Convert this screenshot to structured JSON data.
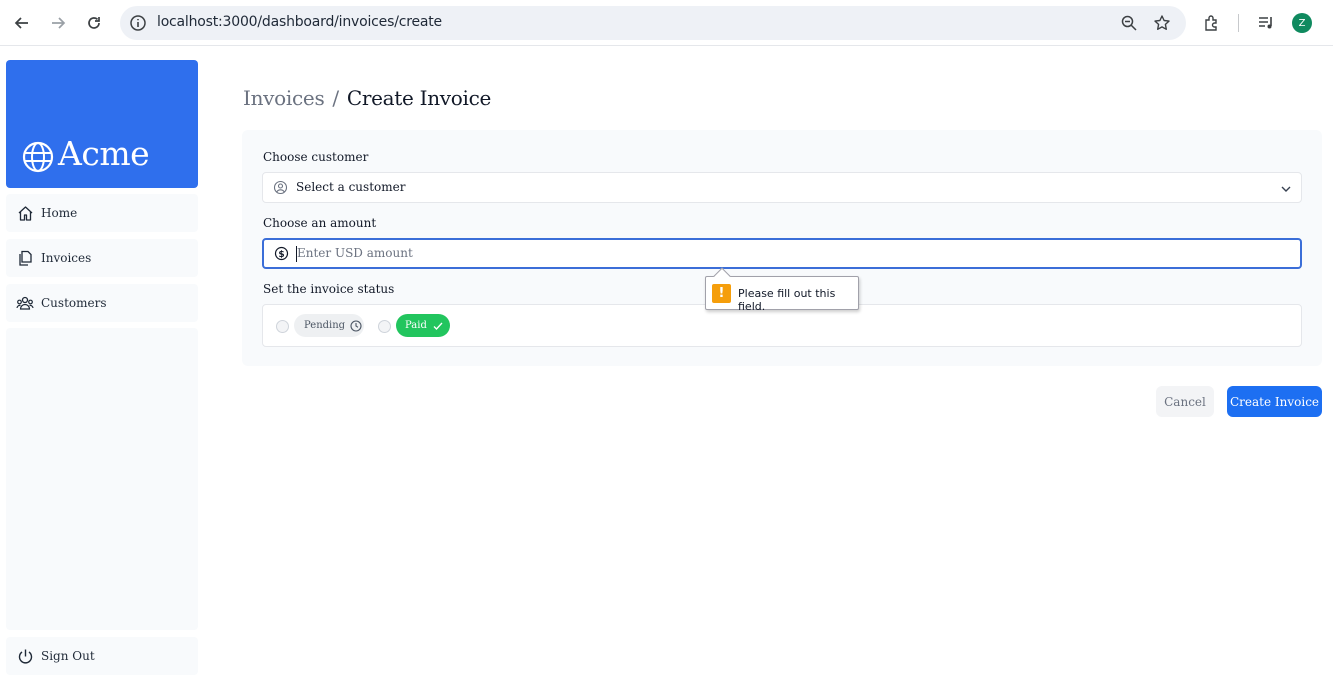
{
  "browser": {
    "url": "localhost:3000/dashboard/invoices/create",
    "profile_initial": "Z",
    "icons": [
      "back-icon",
      "forward-icon",
      "reload-icon",
      "site-info-icon",
      "zoom-icon",
      "bookmark-star-icon",
      "extensions-icon",
      "media-controls-icon"
    ]
  },
  "sidebar": {
    "logo": "Acme",
    "items": [
      {
        "label": "Home",
        "icon": "home-icon"
      },
      {
        "label": "Invoices",
        "icon": "invoices-icon"
      },
      {
        "label": "Customers",
        "icon": "customers-icon"
      }
    ],
    "sign_out": "Sign Out"
  },
  "breadcrumb": {
    "parent": "Invoices",
    "separator": "/",
    "current": "Create Invoice"
  },
  "form": {
    "customer_label": "Choose customer",
    "customer_placeholder": "Select a customer",
    "amount_label": "Choose an amount",
    "amount_placeholder": "Enter USD amount",
    "amount_value": "",
    "status_label": "Set the invoice status",
    "status_options": [
      {
        "label": "Pending",
        "icon": "clock-icon",
        "selected": false
      },
      {
        "label": "Paid",
        "icon": "check-icon",
        "selected": false
      }
    ]
  },
  "validation_tooltip": {
    "message": "Please fill out this field."
  },
  "actions": {
    "cancel": "Cancel",
    "create": "Create Invoice"
  },
  "colors": {
    "brand": "#2f6fed",
    "primary_button": "#1d6ff2",
    "paid_green": "#22c55e",
    "warning": "#f59e0b",
    "focus_border": "#3b6ed8"
  }
}
